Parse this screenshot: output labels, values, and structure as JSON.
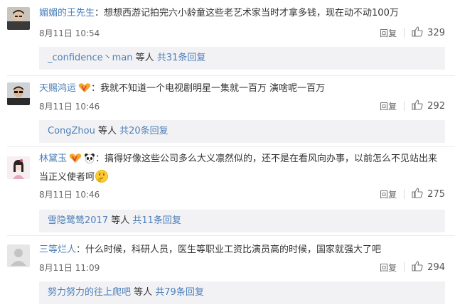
{
  "comments": [
    {
      "username": "媚媚的王先生",
      "badges": [],
      "text": "想想西游记拍完六小龄童这些老艺术家当时才拿多钱，现在动不动100万",
      "date": "8月11日 10:54",
      "reply_label": "回复",
      "likes": "329",
      "reply_user": "_confidence丶man",
      "reply_mid": " 等人 ",
      "reply_more": "共31条回复"
    },
    {
      "username": "天赐鸿运",
      "badges": [
        "vip-badge"
      ],
      "text": "我就不知道一个电视剧明星一集就一百万  演啥呢一百万",
      "date": "8月11日 10:46",
      "reply_label": "回复",
      "likes": "292",
      "reply_user": "CongZhou",
      "reply_mid": " 等人 ",
      "reply_more": "共20条回复"
    },
    {
      "username": "林黛玉",
      "badges": [
        "vip-badge",
        "panda-badge"
      ],
      "text": "搞得好像这些公司多么大义凛然似的，还不是在看风向办事，以前怎么不见站出来",
      "text2": "当正义使者呵",
      "date": "8月11日 10:46",
      "reply_label": "回复",
      "likes": "275",
      "reply_user": "雪隐鹭鸶2017",
      "reply_mid": " 等人 ",
      "reply_more": "共11条回复"
    },
    {
      "username": "三等烂人",
      "badges": [],
      "text": "什么时候，科研人员，医生等职业工资比演员高的时候，国家就强大了吧",
      "date": "8月11日 11:09",
      "reply_label": "回复",
      "likes": "294",
      "reply_user": "努力努力的往上爬吧",
      "reply_mid": " 等人 ",
      "reply_more": "共79条回复"
    }
  ],
  "colors": {
    "username_orange": "#eb7350",
    "link_blue": "#4e80b8",
    "reply_bg": "#f2f2f5"
  },
  "icons": {
    "like": "thumbs-up-icon",
    "vip": "vip-badge-icon",
    "panda": "panda-badge-icon",
    "emoji": "thinking-face-emoji"
  }
}
